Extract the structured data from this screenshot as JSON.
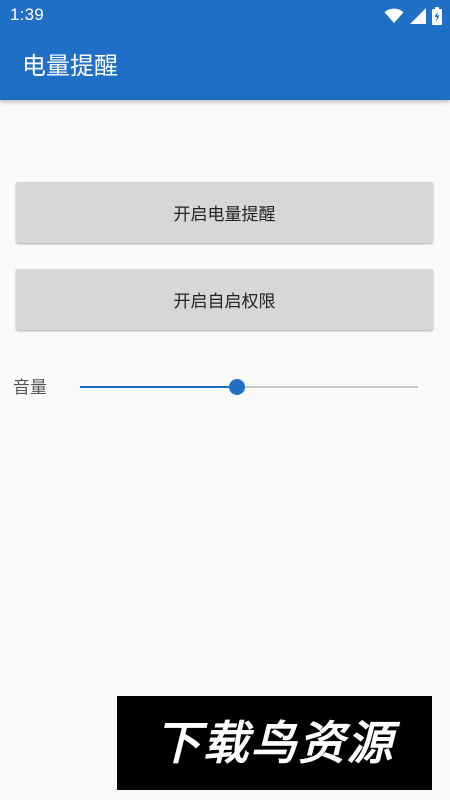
{
  "status_bar": {
    "time": "1:39",
    "icons": [
      "wifi-icon",
      "signal-icon",
      "battery-charging-icon"
    ]
  },
  "app_bar": {
    "title": "电量提醒",
    "color": "#1f6fc6"
  },
  "buttons": {
    "enable_battery_reminder": "开启电量提醒",
    "enable_autostart_permission": "开启自启权限"
  },
  "volume": {
    "label": "音量",
    "value_fraction": 0.465
  },
  "watermark": {
    "text": "下载鸟资源"
  }
}
